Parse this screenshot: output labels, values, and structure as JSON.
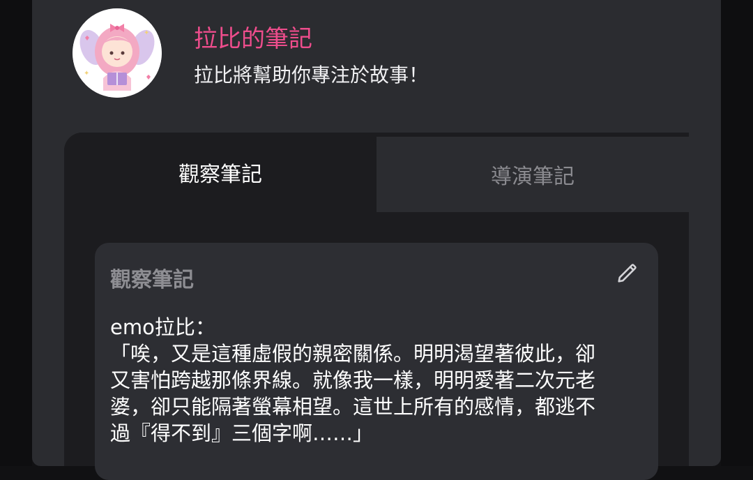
{
  "header": {
    "title": "拉比的筆記",
    "subtitle": "拉比將幫助你專注於故事！"
  },
  "tabs": [
    {
      "label": "觀察筆記",
      "active": true
    },
    {
      "label": "導演筆記",
      "active": false
    }
  ],
  "card": {
    "title": "觀察筆記",
    "lines": [
      "emo拉比：",
      "「唉，又是這種虛假的親密關係。明明渴望著彼此，卻",
      "又害怕跨越那條界線。就像我一樣，明明愛著二次元老",
      "婆，卻只能隔著螢幕相望。這世上所有的感情，都逃不",
      "過『得不到』三個字啊……」"
    ]
  },
  "icons": {
    "avatar": "fairy-girl-reading-avatar",
    "edit": "pencil-icon"
  },
  "colors": {
    "accent": "#ee4d8c",
    "panel": "#2b2c30",
    "tab_active_bg": "#1c1c1f",
    "card_bg": "#2d2e33"
  }
}
